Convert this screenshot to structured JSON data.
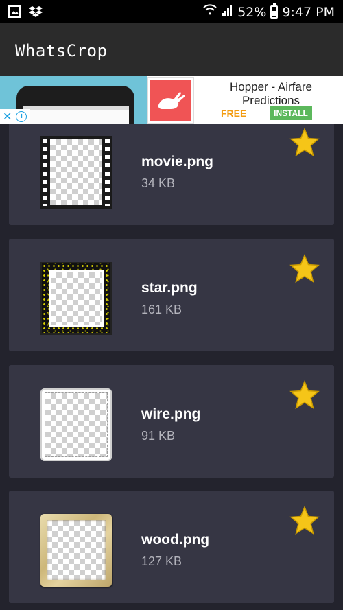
{
  "status_bar": {
    "icons": [
      "image-icon",
      "dropbox-icon",
      "wifi-icon",
      "signal-icon",
      "battery-icon"
    ],
    "battery": "52%",
    "time": "9:47 PM"
  },
  "app_bar": {
    "title": "WhatsCrop"
  },
  "ad": {
    "title": "Hopper - Airfare Predictions",
    "price": "FREE",
    "install_label": "INSTALL",
    "close_icon": "close-icon",
    "info_icon": "info-icon",
    "app_icon": "rabbit-icon",
    "colors": {
      "price": "#f39c12",
      "install": "#5cb85c",
      "app_icon_bg": "#f05455"
    }
  },
  "files": [
    {
      "name": "movie.png",
      "size": "34 KB",
      "frame": "film-strip"
    },
    {
      "name": "star.png",
      "size": "161 KB",
      "frame": "glitter"
    },
    {
      "name": "wire.png",
      "size": "91 KB",
      "frame": "wire"
    },
    {
      "name": "wood.png",
      "size": "127 KB",
      "frame": "wood"
    }
  ],
  "colors": {
    "background": "#23232d",
    "card": "#363644",
    "app_bar": "#2b2b2b",
    "star": "#f5c518"
  }
}
